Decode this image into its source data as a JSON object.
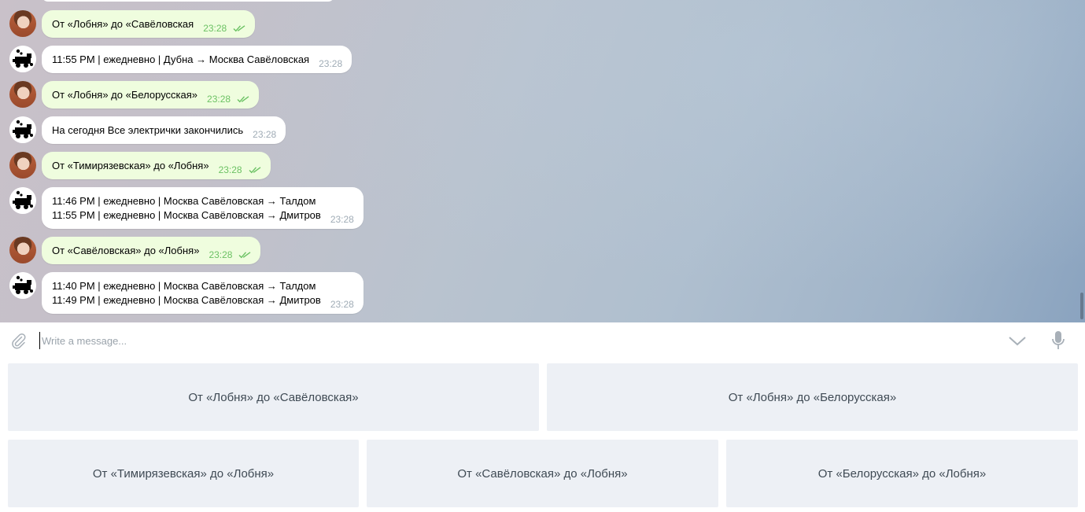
{
  "messages": [
    {
      "side": "out",
      "lines": [
        "От «Лобня» до «Савёловская"
      ],
      "time": "23:28",
      "read": true
    },
    {
      "side": "in",
      "lines": [
        "11:55 PM | ежедневно | Дубна → Москва Савёловская"
      ],
      "time": "23:28"
    },
    {
      "side": "out",
      "lines": [
        "От «Лобня» до «Белорусская»"
      ],
      "time": "23:28",
      "read": true
    },
    {
      "side": "in",
      "lines": [
        "На сегодня Все электрички закончились"
      ],
      "time": "23:28"
    },
    {
      "side": "out",
      "lines": [
        "От «Тимирязевская» до «Лобня»"
      ],
      "time": "23:28",
      "read": true
    },
    {
      "side": "in",
      "lines": [
        "11:46 PM | ежедневно | Москва Савёловская → Талдом",
        "11:55 PM | ежедневно | Москва Савёловская → Дмитров"
      ],
      "time": "23:28"
    },
    {
      "side": "out",
      "lines": [
        "От «Савёловская» до «Лобня»"
      ],
      "time": "23:28",
      "read": true
    },
    {
      "side": "in",
      "lines": [
        "11:40 PM | ежедневно | Москва Савёловская → Талдом",
        "11:49 PM | ежедневно | Москва Савёловская → Дмитров"
      ],
      "time": "23:28"
    }
  ],
  "composer": {
    "placeholder": "Write a message...",
    "value": "",
    "icons": {
      "attach": "paperclip-icon",
      "keyboard_toggle": "chevron-down-icon",
      "voice": "microphone-icon"
    }
  },
  "keyboard": {
    "rows": [
      [
        "От «Лобня» до «Савёловская»",
        "От «Лобня» до «Белорусская»"
      ],
      [
        "От «Тимирязевская» до «Лобня»",
        "От «Савёловская» до «Лобня»",
        "От «Белорусская» до «Лобня»"
      ]
    ]
  },
  "colors": {
    "outgoing_bubble": "#effdde",
    "incoming_bubble": "#ffffff",
    "outgoing_time": "#6cc264",
    "incoming_time": "#a0acb6",
    "keyboard_button": "#edf0f5",
    "keyboard_text": "#3f4a54"
  }
}
